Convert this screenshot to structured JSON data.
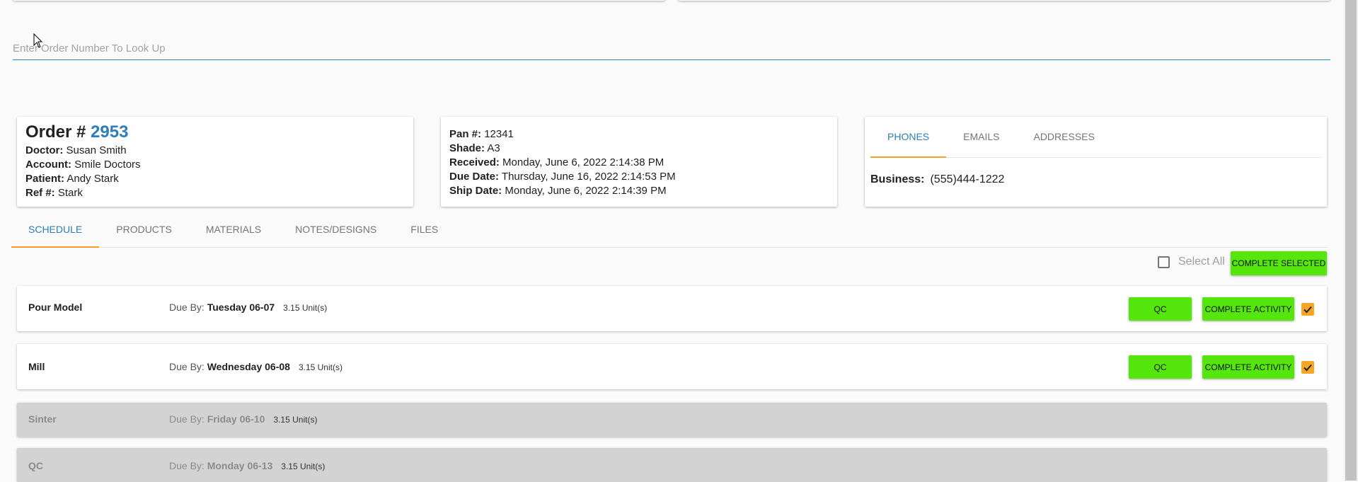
{
  "lookup": {
    "placeholder": "Enter Order Number To Look Up"
  },
  "order": {
    "title_prefix": "Order # ",
    "number": "2953",
    "fields": [
      {
        "label": "Doctor:",
        "value": "Susan Smith"
      },
      {
        "label": "Account:",
        "value": "Smile Doctors"
      },
      {
        "label": "Patient:",
        "value": "Andy Stark"
      },
      {
        "label": "Ref #:",
        "value": "Stark"
      }
    ]
  },
  "pan": {
    "fields": [
      {
        "label": "Pan #:",
        "value": "12341"
      },
      {
        "label": "Shade:",
        "value": "A3"
      },
      {
        "label": "Received:",
        "value": "Monday, June 6, 2022 2:14:38 PM"
      },
      {
        "label": "Due Date:",
        "value": "Thursday, June 16, 2022 2:14:53 PM"
      },
      {
        "label": "Ship Date:",
        "value": "Monday, June 6, 2022 2:14:39 PM"
      }
    ]
  },
  "contact": {
    "tabs": [
      "PHONES",
      "EMAILS",
      "ADDRESSES"
    ],
    "business_label": "Business:",
    "business_phone": "(555)444-1222"
  },
  "tabs": [
    "SCHEDULE",
    "PRODUCTS",
    "MATERIALS",
    "NOTES/DESIGNS",
    "FILES"
  ],
  "toolbar": {
    "select_all": "Select All",
    "complete_selected": "COMPLETE SELECTED"
  },
  "activities": [
    {
      "name": "Pour Model",
      "due_label": "Due By:",
      "due": "Tuesday 06-07",
      "units": "3.15 Unit(s)",
      "qc": "QC",
      "complete": "COMPLETE ACTIVITY"
    },
    {
      "name": "Mill",
      "due_label": "Due By:",
      "due": "Wednesday 06-08",
      "units": "3.15 Unit(s)",
      "qc": "QC",
      "complete": "COMPLETE ACTIVITY"
    },
    {
      "name": "Sinter",
      "due_label": "Due By:",
      "due": "Friday 06-10",
      "units": "3.15 Unit(s)"
    },
    {
      "name": "QC",
      "due_label": "Due By:",
      "due": "Monday 06-13",
      "units": "3.15 Unit(s)"
    }
  ]
}
